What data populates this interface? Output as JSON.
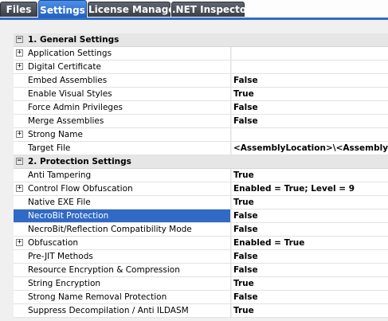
{
  "tabs": [
    {
      "label": "Files"
    },
    {
      "label": "Settings"
    },
    {
      "label": "License Manager"
    },
    {
      "label": ".NET Inspector"
    }
  ],
  "expander": {
    "collapsed": "+",
    "expanded": "−"
  },
  "grid": {
    "rows": [
      {
        "name": "1. General Settings"
      },
      {
        "name": "Application Settings",
        "value": ""
      },
      {
        "name": "Digital Certificate",
        "value": ""
      },
      {
        "name": "Embed Assemblies",
        "value": "False"
      },
      {
        "name": "Enable Visual Styles",
        "value": "True"
      },
      {
        "name": "Force Admin Privileges",
        "value": "False"
      },
      {
        "name": "Merge Assemblies",
        "value": "False"
      },
      {
        "name": "Strong Name",
        "value": ""
      },
      {
        "name": "Target File",
        "value": "<AssemblyLocation>\\<AssemblyName>"
      },
      {
        "name": "2. Protection Settings"
      },
      {
        "name": "Anti Tampering",
        "value": "True"
      },
      {
        "name": "Control Flow Obfuscation",
        "value": "Enabled = True; Level = 9"
      },
      {
        "name": "Native EXE File",
        "value": "True"
      },
      {
        "name": "NecroBit Protection",
        "value": "False"
      },
      {
        "name": "NecroBit/Reflection Compatibility Mode",
        "value": "False"
      },
      {
        "name": "Obfuscation",
        "value": "Enabled = True"
      },
      {
        "name": "Pre-JIT Methods",
        "value": "False"
      },
      {
        "name": "Resource Encryption & Compression",
        "value": "False"
      },
      {
        "name": "String Encryption",
        "value": "True"
      },
      {
        "name": "Strong Name Removal Protection",
        "value": "False"
      },
      {
        "name": "Suppress Decompilation / Anti ILDASM",
        "value": "True"
      }
    ]
  }
}
